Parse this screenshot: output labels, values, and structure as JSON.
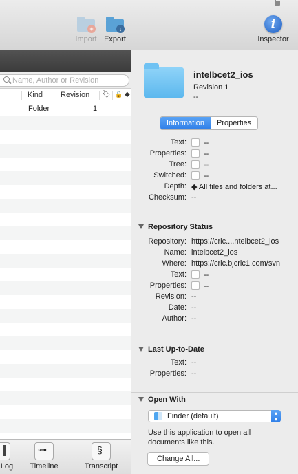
{
  "toolbar": {
    "import_label": "Import",
    "export_label": "Export",
    "inspector_label": "Inspector",
    "accent": "#1e5fc4"
  },
  "browser": {
    "search_placeholder": "Name, Author or Revision",
    "columns": {
      "kind": "Kind",
      "revision": "Revision"
    },
    "rows": [
      {
        "kind": "Folder",
        "revision": "1"
      }
    ],
    "bottom_tabs": {
      "log": "Log",
      "timeline": "Timeline",
      "transcript": "Transcript"
    }
  },
  "inspector": {
    "item_name": "intelbcet2_ios",
    "revision": "Revision  1",
    "revision_sub": "--",
    "tabs": {
      "information": "Information",
      "properties": "Properties"
    },
    "info": {
      "text_label": "Text:",
      "text_value": "--",
      "properties_label": "Properties:",
      "properties_value": "--",
      "tree_label": "Tree:",
      "tree_value": "--",
      "switched_label": "Switched:",
      "switched_value": "--",
      "depth_label": "Depth:",
      "depth_value": "All files and folders at...",
      "checksum_label": "Checksum:",
      "checksum_value": "--"
    },
    "repo_status": {
      "title": "Repository Status",
      "repository_label": "Repository:",
      "repository_value": "https://cric....ntelbcet2_ios",
      "name_label": "Name:",
      "name_value": "intelbcet2_ios",
      "where_label": "Where:",
      "where_value": "https://cric.bjcric1.com/svn",
      "text_label": "Text:",
      "text_value": "--",
      "properties_label": "Properties:",
      "properties_value": "--",
      "revision_label": "Revision:",
      "revision_value": "--",
      "date_label": "Date:",
      "date_value": "--",
      "author_label": "Author:",
      "author_value": "--"
    },
    "last_up_to_date": {
      "title": "Last Up-to-Date",
      "text_label": "Text:",
      "text_value": "--",
      "properties_label": "Properties:",
      "properties_value": "--"
    },
    "open_with": {
      "title": "Open With",
      "selected_app": "Finder (default)",
      "description": "Use this application to open all documents like this.",
      "change_all_label": "Change All..."
    }
  }
}
